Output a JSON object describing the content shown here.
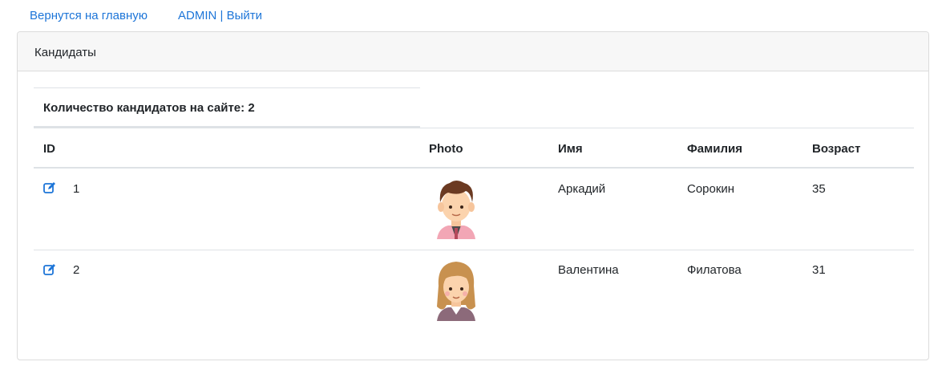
{
  "nav": {
    "home_link": "Вернутся на главную",
    "user_logout": "ADMIN | Выйти"
  },
  "card": {
    "title": "Кандидаты",
    "count_text": "Количество кандидатов на сайте: 2"
  },
  "table": {
    "headers": {
      "id": "ID",
      "photo": "Photo",
      "first_name": "Имя",
      "last_name": "Фамилия",
      "age": "Возраст"
    },
    "rows": [
      {
        "id": "1",
        "first_name": "Аркадий",
        "last_name": "Сорокин",
        "age": "35",
        "avatar": "male-avatar"
      },
      {
        "id": "2",
        "first_name": "Валентина",
        "last_name": "Филатова",
        "age": "31",
        "avatar": "female-avatar"
      }
    ]
  },
  "colors": {
    "link": "#1d75d8",
    "header_bg": "#f7f7f7",
    "border": "#dee2e6"
  },
  "icons": {
    "edit": "edit-pencil-icon"
  }
}
